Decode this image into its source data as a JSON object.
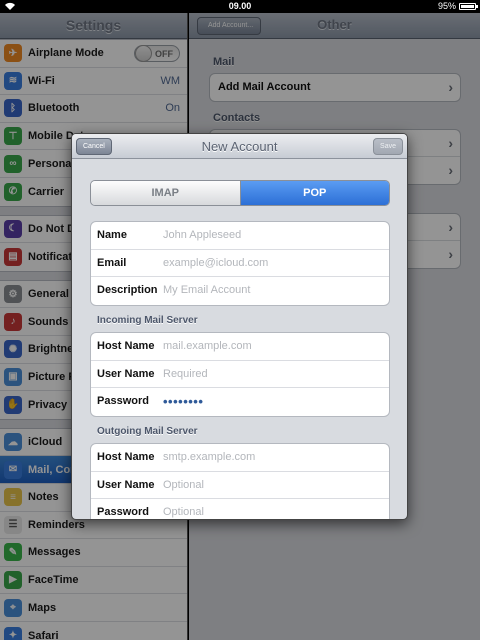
{
  "status": {
    "time": "09.00",
    "battery": "95%"
  },
  "master": {
    "title": "Settings",
    "groups": [
      [
        {
          "label": "Airplane Mode",
          "icon": "airplane-icon",
          "toggle": "OFF"
        },
        {
          "label": "Wi-Fi",
          "icon": "wifi-icon",
          "value": "WM"
        },
        {
          "label": "Bluetooth",
          "icon": "bluetooth-icon",
          "value": "On"
        },
        {
          "label": "Mobile Data",
          "icon": "antenna-icon"
        },
        {
          "label": "Personal Hotspot",
          "icon": "hotspot-icon"
        },
        {
          "label": "Carrier",
          "icon": "phone-icon"
        }
      ],
      [
        {
          "label": "Do Not Disturb",
          "icon": "moon-icon"
        },
        {
          "label": "Notifications",
          "icon": "notifications-icon"
        }
      ],
      [
        {
          "label": "General",
          "icon": "gear-icon"
        },
        {
          "label": "Sounds",
          "icon": "speaker-icon"
        },
        {
          "label": "Brightness & Wallpaper",
          "icon": "brightness-icon"
        },
        {
          "label": "Picture Frame",
          "icon": "picture-frame-icon"
        },
        {
          "label": "Privacy",
          "icon": "hand-icon"
        }
      ],
      [
        {
          "label": "iCloud",
          "icon": "cloud-icon"
        },
        {
          "label": "Mail, Contacts, Calendars",
          "icon": "mail-icon",
          "selected": true
        },
        {
          "label": "Notes",
          "icon": "notes-icon"
        },
        {
          "label": "Reminders",
          "icon": "reminders-icon"
        },
        {
          "label": "Messages",
          "icon": "messages-icon"
        },
        {
          "label": "FaceTime",
          "icon": "facetime-icon"
        },
        {
          "label": "Maps",
          "icon": "maps-icon"
        },
        {
          "label": "Safari",
          "icon": "compass-icon"
        }
      ]
    ]
  },
  "detail": {
    "title": "Other",
    "back_label": "Add Account...",
    "mail_header": "Mail",
    "add_mail_account": "Add Mail Account",
    "contacts_header": "Contacts"
  },
  "modal": {
    "title": "New Account",
    "cancel_label": "Cancel",
    "save_label": "Save",
    "segments": {
      "imap": "IMAP",
      "pop": "POP",
      "selected": "POP"
    },
    "account_fields": [
      {
        "label": "Name",
        "placeholder": "John Appleseed"
      },
      {
        "label": "Email",
        "placeholder": "example@icloud.com"
      },
      {
        "label": "Description",
        "placeholder": "My Email Account"
      }
    ],
    "incoming_header": "Incoming Mail Server",
    "incoming_fields": [
      {
        "label": "Host Name",
        "placeholder": "mail.example.com"
      },
      {
        "label": "User Name",
        "placeholder": "Required"
      },
      {
        "label": "Password",
        "value": "••••••••"
      }
    ],
    "outgoing_header": "Outgoing Mail Server",
    "outgoing_fields": [
      {
        "label": "Host Name",
        "placeholder": "smtp.example.com"
      },
      {
        "label": "User Name",
        "placeholder": "Optional"
      },
      {
        "label": "Password",
        "placeholder": "Optional"
      }
    ]
  },
  "colors": {
    "accent": "#2c6fd6",
    "selected_row": "#1e5fc2",
    "placeholder": "#b3b6bb"
  }
}
